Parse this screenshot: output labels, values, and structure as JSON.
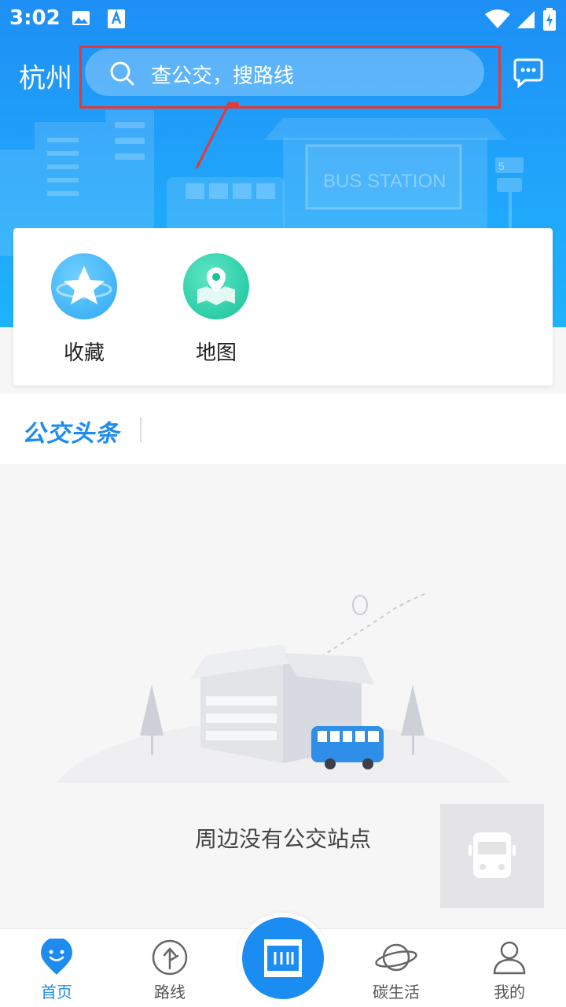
{
  "status_bar": {
    "time": "3:02"
  },
  "header": {
    "city": "杭州",
    "search_placeholder": "查公交，搜路线",
    "bus_station_sign": "BUS STATION",
    "stop_sign_number": "5"
  },
  "quick_actions": [
    {
      "label": "收藏",
      "icon": "star-icon",
      "color": "#2fa7f5"
    },
    {
      "label": "地图",
      "icon": "map-pin-icon",
      "color": "#22c9a3"
    }
  ],
  "news": {
    "tag": "公交头条"
  },
  "empty_state": {
    "message": "周边没有公交站点"
  },
  "tabbar": {
    "items": [
      {
        "label": "首页",
        "icon": "home-smile-icon",
        "active": true
      },
      {
        "label": "路线",
        "icon": "route-icon",
        "active": false
      },
      {
        "label": "碳生活",
        "icon": "planet-icon",
        "active": false
      },
      {
        "label": "我的",
        "icon": "user-icon",
        "active": false
      }
    ],
    "center_button_icon": "scan-barcode-icon"
  },
  "colors": {
    "accent": "#1d8bef",
    "highlight": "#e53935"
  }
}
